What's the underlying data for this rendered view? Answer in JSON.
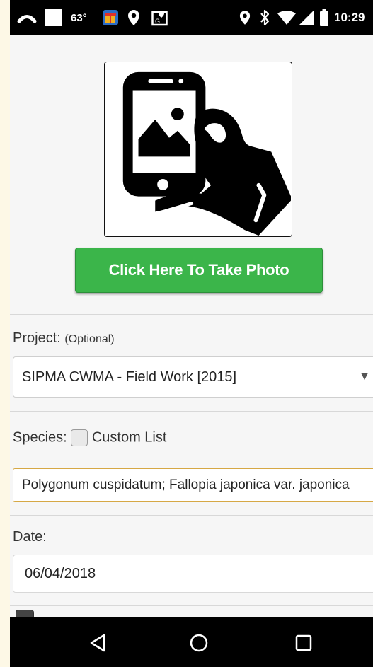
{
  "status_bar": {
    "temperature": "63°",
    "time": "10:29"
  },
  "photo": {
    "image_icon": "phone-photo-in-hand-icon",
    "button_label": "Click Here To Take Photo"
  },
  "project": {
    "label": "Project:",
    "optional": "(Optional)",
    "selected": "SIPMA CWMA - Field Work [2015]"
  },
  "species": {
    "label": "Species:",
    "custom_list_label": "Custom List",
    "custom_list_checked": false,
    "value": "Polygonum cuspidatum; Fallopia japonica var. japonica"
  },
  "date": {
    "label": "Date:",
    "value": "06/04/2018"
  },
  "colors": {
    "accent_green": "#3bb54a",
    "input_focus_border": "#d6a845"
  }
}
